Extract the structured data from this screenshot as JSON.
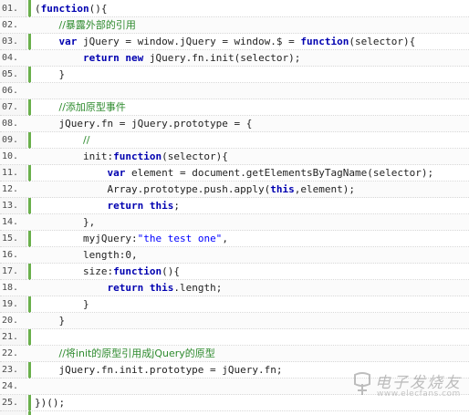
{
  "code": {
    "lines": [
      {
        "no": "01.",
        "tokens": [
          {
            "t": "("
          },
          {
            "t": "function",
            "k": "kw"
          },
          {
            "t": "(){"
          }
        ]
      },
      {
        "no": "02.",
        "tokens": [
          {
            "t": "    "
          },
          {
            "t": "//暴露外部的引用",
            "k": "cm"
          }
        ]
      },
      {
        "no": "03.",
        "tokens": [
          {
            "t": "    "
          },
          {
            "t": "var",
            "k": "kw"
          },
          {
            "t": " jQuery = window.jQuery = window.$ = "
          },
          {
            "t": "function",
            "k": "kw"
          },
          {
            "t": "(selector){"
          }
        ]
      },
      {
        "no": "04.",
        "tokens": [
          {
            "t": "        "
          },
          {
            "t": "return",
            "k": "kw"
          },
          {
            "t": " "
          },
          {
            "t": "new",
            "k": "kw"
          },
          {
            "t": " jQuery.fn.init(selector);"
          }
        ]
      },
      {
        "no": "05.",
        "tokens": [
          {
            "t": "    }"
          }
        ]
      },
      {
        "no": "06.",
        "tokens": []
      },
      {
        "no": "07.",
        "tokens": [
          {
            "t": "    "
          },
          {
            "t": "//添加原型事件",
            "k": "cm"
          }
        ]
      },
      {
        "no": "08.",
        "tokens": [
          {
            "t": "    jQuery.fn = jQuery.prototype = {"
          }
        ]
      },
      {
        "no": "09.",
        "tokens": [
          {
            "t": "        "
          },
          {
            "t": "//",
            "k": "cm"
          }
        ]
      },
      {
        "no": "10.",
        "tokens": [
          {
            "t": "        init:"
          },
          {
            "t": "function",
            "k": "kw"
          },
          {
            "t": "(selector){"
          }
        ]
      },
      {
        "no": "11.",
        "tokens": [
          {
            "t": "            "
          },
          {
            "t": "var",
            "k": "kw"
          },
          {
            "t": " element = document.getElementsByTagName(selector);"
          }
        ]
      },
      {
        "no": "12.",
        "tokens": [
          {
            "t": "            Array.prototype.push.apply("
          },
          {
            "t": "this",
            "k": "kw"
          },
          {
            "t": ",element);"
          }
        ]
      },
      {
        "no": "13.",
        "tokens": [
          {
            "t": "            "
          },
          {
            "t": "return",
            "k": "kw"
          },
          {
            "t": " "
          },
          {
            "t": "this",
            "k": "kw"
          },
          {
            "t": ";"
          }
        ]
      },
      {
        "no": "14.",
        "tokens": [
          {
            "t": "        },"
          }
        ]
      },
      {
        "no": "15.",
        "tokens": [
          {
            "t": "        myjQuery:"
          },
          {
            "t": "\"the test one\"",
            "k": "st"
          },
          {
            "t": ","
          }
        ]
      },
      {
        "no": "16.",
        "tokens": [
          {
            "t": "        length:0,"
          }
        ]
      },
      {
        "no": "17.",
        "tokens": [
          {
            "t": "        size:"
          },
          {
            "t": "function",
            "k": "kw"
          },
          {
            "t": "(){"
          }
        ]
      },
      {
        "no": "18.",
        "tokens": [
          {
            "t": "            "
          },
          {
            "t": "return",
            "k": "kw"
          },
          {
            "t": " "
          },
          {
            "t": "this",
            "k": "kw"
          },
          {
            "t": ".length;"
          }
        ]
      },
      {
        "no": "19.",
        "tokens": [
          {
            "t": "        }"
          }
        ]
      },
      {
        "no": "20.",
        "tokens": [
          {
            "t": "    }"
          }
        ]
      },
      {
        "no": "21.",
        "tokens": []
      },
      {
        "no": "22.",
        "tokens": [
          {
            "t": "    "
          },
          {
            "t": "//将init的原型引用成jQuery的原型",
            "k": "cm"
          }
        ]
      },
      {
        "no": "23.",
        "tokens": [
          {
            "t": "    jQuery.fn.init.prototype = jQuery.fn;"
          }
        ]
      },
      {
        "no": "24.",
        "tokens": []
      },
      {
        "no": "25.",
        "tokens": [
          {
            "t": "})();"
          }
        ]
      }
    ]
  },
  "watermark": {
    "title": "电子发烧友",
    "subtitle": "www.elecfans.com"
  },
  "colors": {
    "keyword": "#0000b0",
    "comment": "#2e8b2e",
    "string": "#0000ff",
    "accent_bar": "#6ab04c",
    "gutter": "#f7f7f7"
  }
}
